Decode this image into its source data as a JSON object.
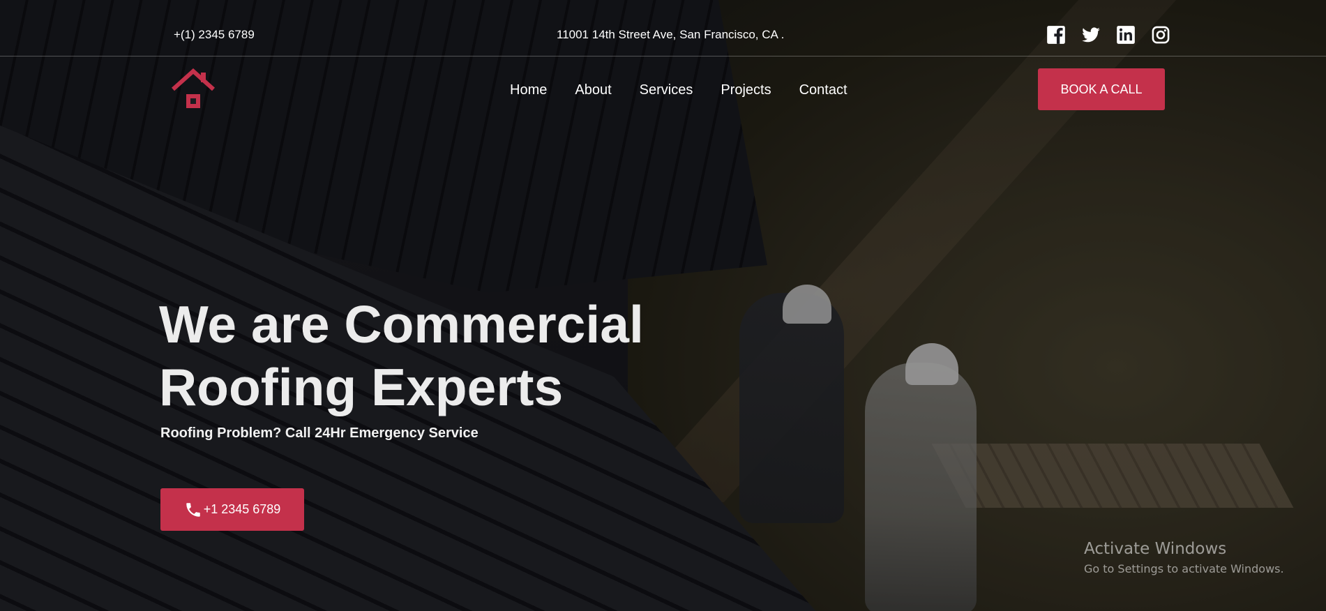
{
  "topbar": {
    "phone": "+(1) 2345 6789",
    "address": "11001 14th Street Ave, San Francisco, CA .",
    "socials": [
      "facebook-icon",
      "twitter-icon",
      "linkedin-icon",
      "instagram-icon"
    ]
  },
  "nav": {
    "items": [
      {
        "label": "Home"
      },
      {
        "label": "About"
      },
      {
        "label": "Services"
      },
      {
        "label": "Projects"
      },
      {
        "label": "Contact"
      }
    ],
    "book_button": "BOOK A CALL"
  },
  "hero": {
    "headline_line1": "We are Commercial",
    "headline_line2": "Roofing Experts",
    "subheadline": "Roofing Problem? Call 24Hr Emergency Service",
    "call_button": "+1 2345 6789",
    "call_icon": "phone-icon"
  },
  "watermark": {
    "title": "Activate Windows",
    "subtitle": "Go to Settings to activate Windows."
  },
  "colors": {
    "accent": "#c4314b",
    "text": "#ffffff",
    "overlay": "#000000"
  }
}
